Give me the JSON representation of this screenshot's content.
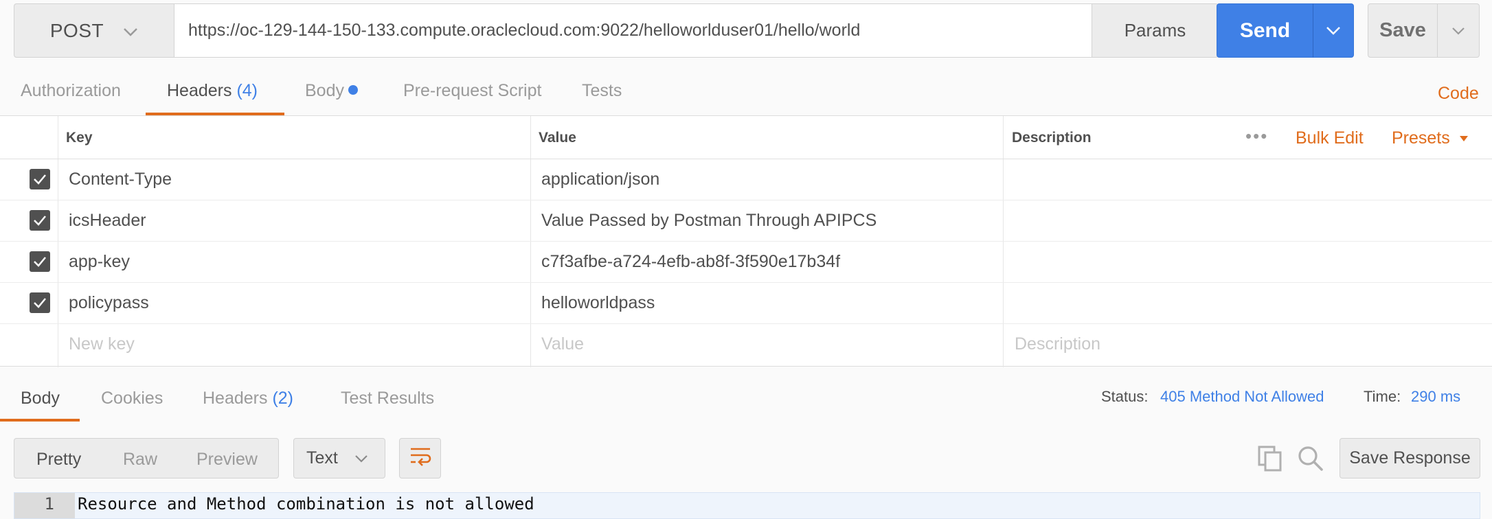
{
  "request": {
    "method": "POST",
    "url": "https://oc-129-144-150-133.compute.oraclecloud.com:9022/helloworlduser01/hello/world",
    "params_label": "Params",
    "send_label": "Send",
    "save_label": "Save"
  },
  "request_tabs": {
    "authorization": "Authorization",
    "headers": "Headers",
    "headers_count": "(4)",
    "body": "Body",
    "prerequest": "Pre-request Script",
    "tests": "Tests",
    "code": "Code"
  },
  "headers_table": {
    "columns": {
      "key": "Key",
      "value": "Value",
      "description": "Description"
    },
    "bulk_edit": "Bulk Edit",
    "presets": "Presets",
    "rows": [
      {
        "key": "Content-Type",
        "value": "application/json",
        "checked": true
      },
      {
        "key": "icsHeader",
        "value": "Value Passed by Postman Through APIPCS",
        "checked": true
      },
      {
        "key": "app-key",
        "value": "c7f3afbe-a724-4efb-ab8f-3f590e17b34f",
        "checked": true
      },
      {
        "key": "policypass",
        "value": "helloworldpass",
        "checked": true
      }
    ],
    "new_row": {
      "key_placeholder": "New key",
      "value_placeholder": "Value",
      "description_placeholder": "Description"
    }
  },
  "response_tabs": {
    "body": "Body",
    "cookies": "Cookies",
    "headers": "Headers",
    "headers_count": "(2)",
    "test_results": "Test Results"
  },
  "response_meta": {
    "status_label": "Status:",
    "status_value": "405 Method Not Allowed",
    "time_label": "Time:",
    "time_value": "290 ms"
  },
  "response_toolbar": {
    "pretty": "Pretty",
    "raw": "Raw",
    "preview": "Preview",
    "format": "Text",
    "save_response": "Save Response"
  },
  "response_body": {
    "line_number": "1",
    "line_text": "Resource and Method combination is not allowed"
  },
  "colors": {
    "accent_orange": "#e06c1c",
    "accent_blue": "#3f80e6"
  },
  "icons": [
    "chevron-down-icon",
    "checkbox-checked-icon",
    "more-dots-icon",
    "caret-down-icon",
    "wrap-lines-icon",
    "copy-icon",
    "search-icon"
  ]
}
